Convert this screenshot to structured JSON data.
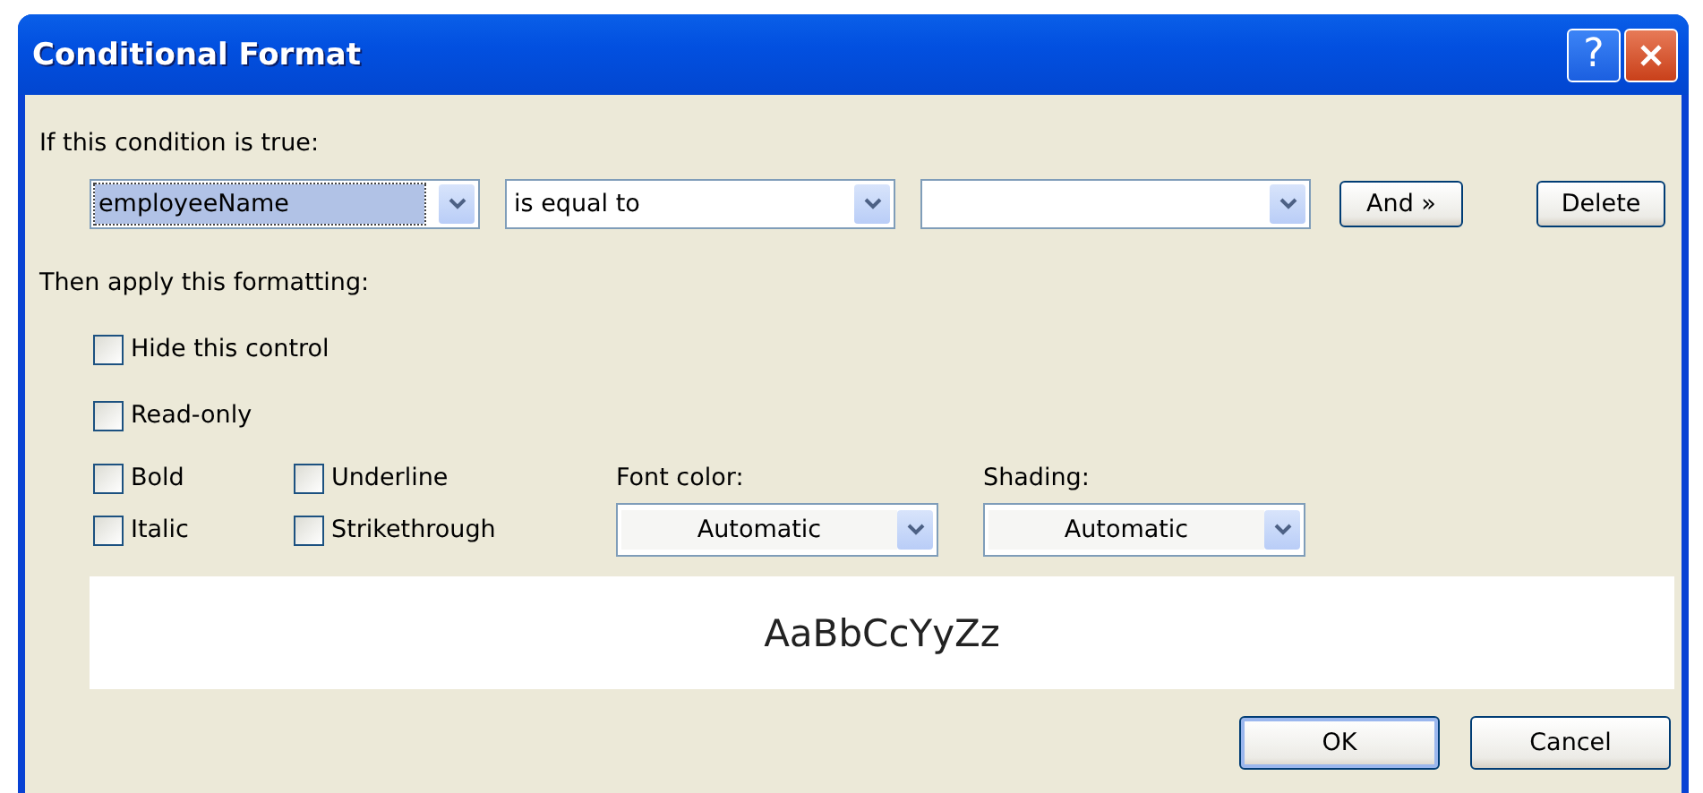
{
  "window": {
    "title": "Conditional Format",
    "buttons": [
      {
        "kind": "help",
        "label": "?"
      },
      {
        "kind": "close"
      }
    ]
  },
  "condition": {
    "label": "If this condition is true:",
    "combos": [
      {
        "value": "employeeName",
        "selected": true
      },
      {
        "value": "is equal to",
        "selected": false
      },
      {
        "selected": false
      }
    ],
    "buttons": [
      "And »",
      "Delete"
    ]
  },
  "formatting": {
    "label": "Then apply this formatting:",
    "options": [
      {
        "label": "Hide this control",
        "checked": false
      },
      {
        "label": "Read-only",
        "checked": false
      }
    ],
    "styles": [
      {
        "label": "Bold",
        "checked": false
      },
      {
        "label": "Underline",
        "checked": false
      },
      {
        "label": "Italic",
        "checked": false
      },
      {
        "label": "Strikethrough",
        "checked": false
      }
    ],
    "font_color": {
      "label": "Font color:",
      "value": "Automatic"
    },
    "shading": {
      "label": "Shading:",
      "value": "Automatic"
    },
    "preview": "AaBbCcYyZz"
  },
  "buttons": [
    {
      "label": "OK",
      "default": true
    },
    {
      "label": "Cancel",
      "default": false
    }
  ]
}
